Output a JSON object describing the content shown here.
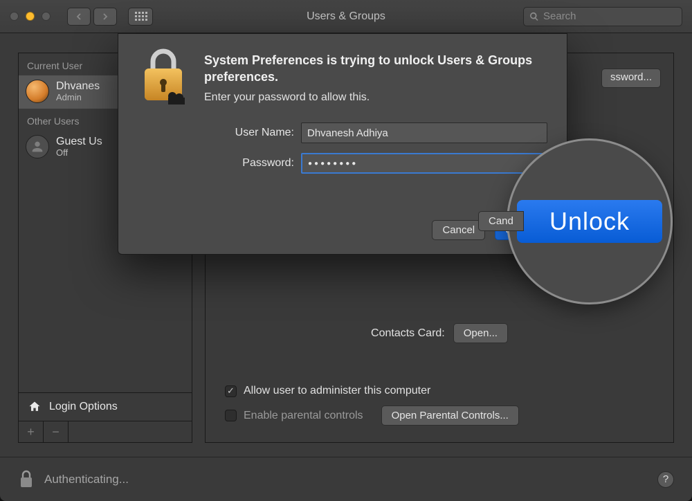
{
  "window": {
    "title": "Users & Groups"
  },
  "toolbar": {
    "search_placeholder": "Search"
  },
  "sidebar": {
    "current_label": "Current User",
    "other_label": "Other Users",
    "users": [
      {
        "name": "Dhvanes",
        "role": "Admin",
        "selected": true
      },
      {
        "name": "Guest Us",
        "role": "Off",
        "selected": false
      }
    ],
    "login_options": "Login Options",
    "add_label": "+",
    "remove_label": "−"
  },
  "content": {
    "change_password": "ssword...",
    "contacts_card_label": "Contacts Card:",
    "open_label": "Open...",
    "admin_checkbox": "Allow user to administer this computer",
    "parental_label": "Enable parental controls",
    "parental_button": "Open Parental Controls..."
  },
  "status": {
    "text": "Authenticating..."
  },
  "auth_dialog": {
    "title": "System Preferences is trying to unlock Users & Groups preferences.",
    "subtitle": "Enter your password to allow this.",
    "username_label": "User Name:",
    "username_value": "Dhvanesh Adhiya",
    "password_label": "Password:",
    "password_value": "●●●●●●●●",
    "cancel": "Cancel",
    "unlock": "Unlock"
  },
  "magnifier": {
    "label": "Unlock",
    "cancel_fragment": "Cand"
  }
}
